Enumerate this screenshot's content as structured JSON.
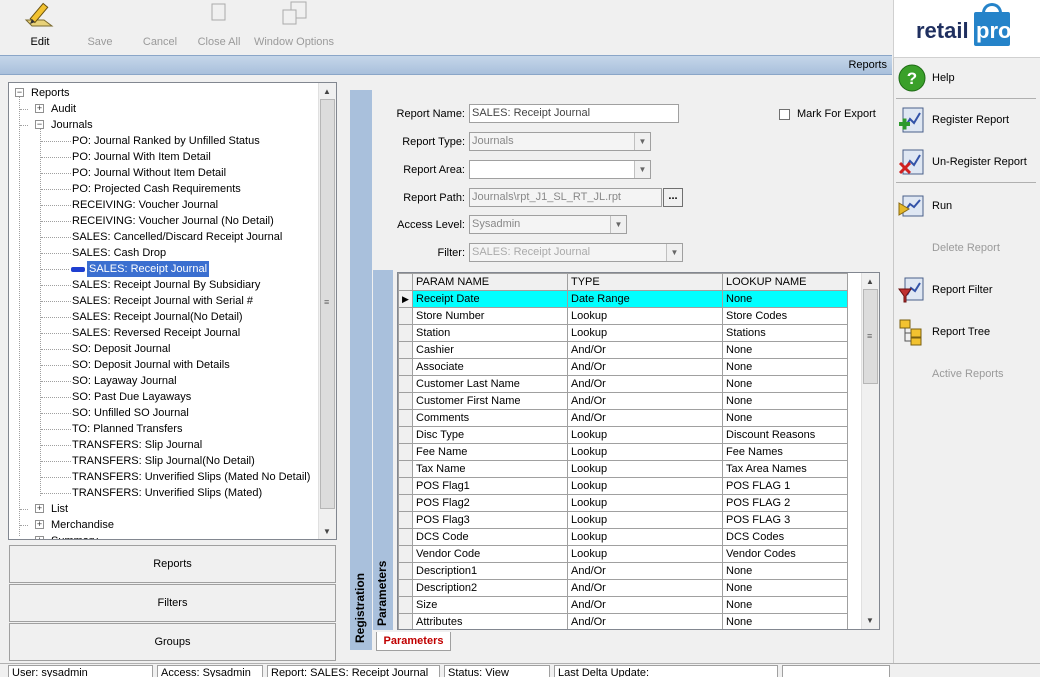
{
  "toolbar": {
    "edit": "Edit",
    "save": "Save",
    "cancel": "Cancel",
    "close_all": "Close All",
    "window_options": "Window Options"
  },
  "logo": {
    "text_left": "retail",
    "text_right": "pro"
  },
  "title_bar": {
    "title": "Reports"
  },
  "tree": {
    "root": "Reports",
    "items": [
      {
        "label": "Audit",
        "level": 1,
        "expander": "+"
      },
      {
        "label": "Journals",
        "level": 1,
        "expander": "-"
      },
      {
        "label": "PO: Journal Ranked by Unfilled Status",
        "level": 2
      },
      {
        "label": "PO: Journal With Item Detail",
        "level": 2
      },
      {
        "label": "PO: Journal Without Item Detail",
        "level": 2
      },
      {
        "label": "PO: Projected Cash Requirements",
        "level": 2
      },
      {
        "label": "RECEIVING: Voucher Journal",
        "level": 2
      },
      {
        "label": "RECEIVING: Voucher Journal (No Detail)",
        "level": 2
      },
      {
        "label": "SALES: Cancelled/Discard Receipt Journal",
        "level": 2
      },
      {
        "label": "SALES: Cash Drop",
        "level": 2
      },
      {
        "label": "SALES: Receipt Journal",
        "level": 2,
        "selected": true
      },
      {
        "label": "SALES: Receipt Journal By Subsidiary",
        "level": 2
      },
      {
        "label": "SALES: Receipt Journal with Serial #",
        "level": 2
      },
      {
        "label": "SALES: Receipt Journal(No Detail)",
        "level": 2
      },
      {
        "label": "SALES: Reversed Receipt Journal",
        "level": 2
      },
      {
        "label": "SO: Deposit Journal",
        "level": 2
      },
      {
        "label": "SO: Deposit Journal with Details",
        "level": 2
      },
      {
        "label": "SO: Layaway Journal",
        "level": 2
      },
      {
        "label": "SO: Past Due Layaways",
        "level": 2
      },
      {
        "label": "SO: Unfilled SO Journal",
        "level": 2
      },
      {
        "label": "TO: Planned Transfers",
        "level": 2
      },
      {
        "label": "TRANSFERS: Slip Journal",
        "level": 2
      },
      {
        "label": "TRANSFERS: Slip Journal(No Detail)",
        "level": 2
      },
      {
        "label": "TRANSFERS: Unverified Slips (Mated No Detail)",
        "level": 2
      },
      {
        "label": "TRANSFERS: Unverified Slips (Mated)",
        "level": 2
      },
      {
        "label": "List",
        "level": 1,
        "expander": "+"
      },
      {
        "label": "Merchandise",
        "level": 1,
        "expander": "+"
      },
      {
        "label": "Summary",
        "level": 1,
        "expander": "+"
      }
    ]
  },
  "nav_buttons": {
    "reports": "Reports",
    "filters": "Filters",
    "groups": "Groups"
  },
  "form": {
    "report_name_label": "Report Name:",
    "report_name_value": "SALES: Receipt Journal",
    "mark_for_export_label": "Mark For Export",
    "report_type_label": "Report Type:",
    "report_type_value": "Journals",
    "report_area_label": "Report Area:",
    "report_area_value": "",
    "report_path_label": "Report Path:",
    "report_path_value": "Journals\\rpt_J1_SL_RT_JL.rpt",
    "browse_label": "...",
    "access_level_label": "Access Level:",
    "access_level_value": "Sysadmin",
    "filter_label": "Filter:",
    "filter_value": "SALES: Receipt Journal"
  },
  "vertical_tabs": {
    "registration": "Registration",
    "parameters": "Parameters"
  },
  "grid": {
    "columns": [
      "PARAM NAME",
      "TYPE",
      "LOOKUP NAME"
    ],
    "rows": [
      [
        "Receipt Date",
        "Date Range",
        "None"
      ],
      [
        "Store Number",
        "Lookup",
        "Store Codes"
      ],
      [
        "Station",
        "Lookup",
        "Stations"
      ],
      [
        "Cashier",
        "And/Or",
        "None"
      ],
      [
        "Associate",
        "And/Or",
        "None"
      ],
      [
        "Customer Last Name",
        "And/Or",
        "None"
      ],
      [
        "Customer First Name",
        "And/Or",
        "None"
      ],
      [
        "Comments",
        "And/Or",
        "None"
      ],
      [
        "Disc Type",
        "Lookup",
        "Discount Reasons"
      ],
      [
        "Fee Name",
        "Lookup",
        "Fee Names"
      ],
      [
        "Tax Name",
        "Lookup",
        "Tax Area Names"
      ],
      [
        "POS Flag1",
        "Lookup",
        "POS FLAG 1"
      ],
      [
        "POS Flag2",
        "Lookup",
        "POS FLAG 2"
      ],
      [
        "POS Flag3",
        "Lookup",
        "POS FLAG 3"
      ],
      [
        "DCS Code",
        "Lookup",
        "DCS Codes"
      ],
      [
        "Vendor Code",
        "Lookup",
        "Vendor Codes"
      ],
      [
        "Description1",
        "And/Or",
        "None"
      ],
      [
        "Description2",
        "And/Or",
        "None"
      ],
      [
        "Size",
        "And/Or",
        "None"
      ],
      [
        "Attributes",
        "And/Or",
        "None"
      ]
    ],
    "bottom_tab": "Parameters"
  },
  "right_panel": {
    "help": "Help",
    "register_report": "Register Report",
    "unregister_report": "Un-Register Report",
    "run": "Run",
    "delete_report": "Delete Report",
    "report_filter": "Report Filter",
    "report_tree": "Report Tree",
    "active_reports": "Active Reports"
  },
  "status_bar": {
    "user": "User: sysadmin",
    "access": "Access: Sysadmin",
    "report": "Report: SALES: Receipt Journal",
    "status": "Status: View",
    "last_delta": "Last Delta Update:"
  }
}
